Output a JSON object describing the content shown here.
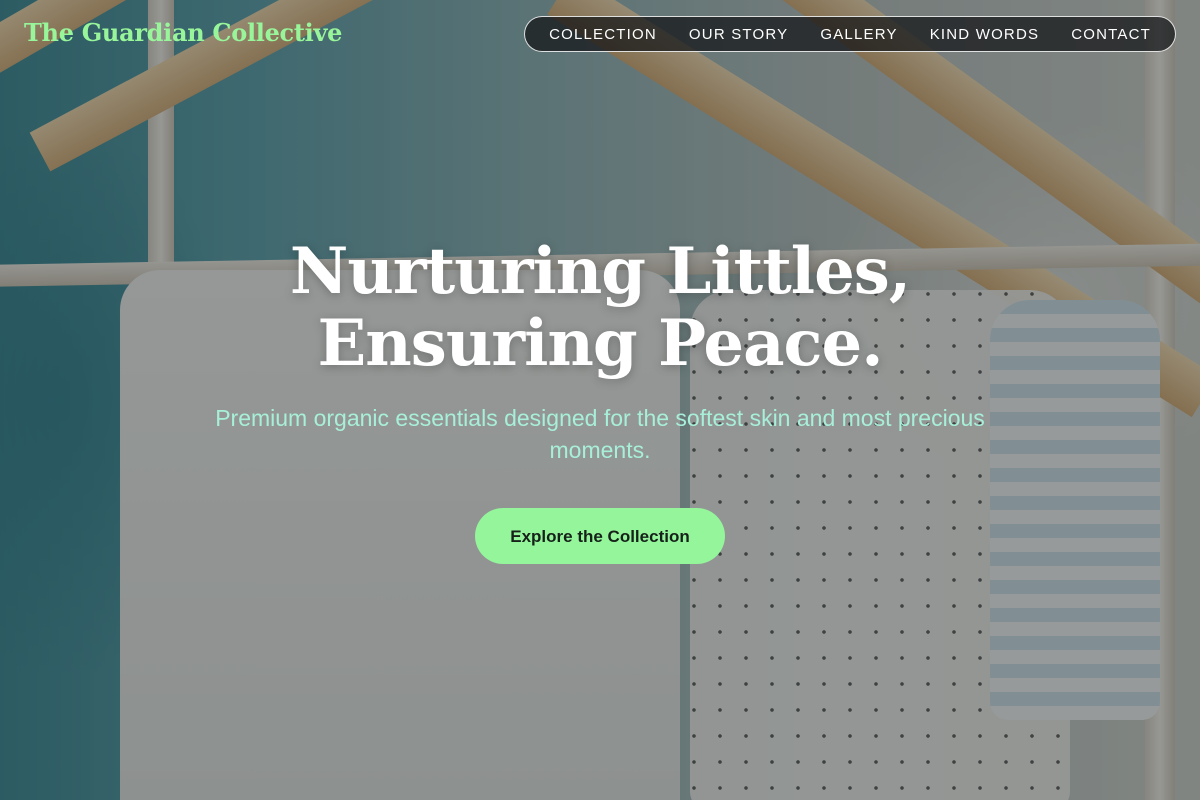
{
  "site": {
    "logo": "The Guardian Collective"
  },
  "nav": {
    "items": [
      {
        "label": "COLLECTION"
      },
      {
        "label": "OUR STORY"
      },
      {
        "label": "GALLERY"
      },
      {
        "label": "KIND WORDS"
      },
      {
        "label": "CONTACT"
      }
    ]
  },
  "hero": {
    "headline_line1": "Nurturing Littles,",
    "headline_line2": "Ensuring Peace.",
    "subheading": "Premium organic essentials designed for the softest skin and most precious moments.",
    "cta_label": "Explore the Collection"
  },
  "colors": {
    "accent": "#94f59a",
    "subheading_text": "#a8efd9",
    "nav_background": "#121416"
  }
}
